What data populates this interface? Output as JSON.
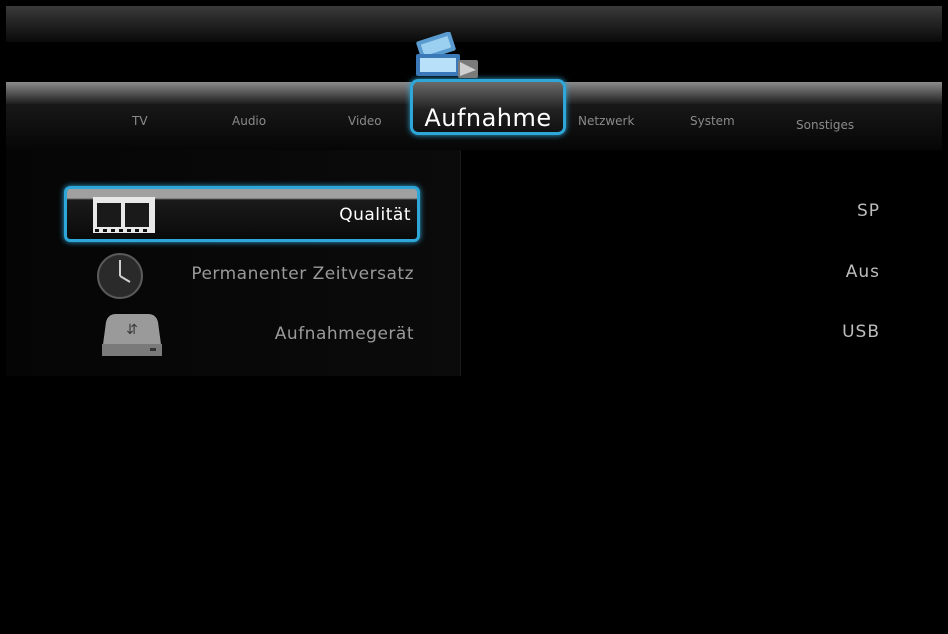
{
  "menu": {
    "tabs": [
      {
        "label": "TV"
      },
      {
        "label": "Audio"
      },
      {
        "label": "Video"
      },
      {
        "label": "Aufnahme"
      },
      {
        "label": "Netzwerk"
      },
      {
        "label": "System"
      },
      {
        "label": "Sonstiges"
      }
    ],
    "active_tab": "Aufnahme"
  },
  "settings": {
    "items": [
      {
        "label": "Qualität",
        "value": "SP",
        "icon": "film-strip-icon",
        "selected": true
      },
      {
        "label": "Permanenter Zeitversatz",
        "value": "Aus",
        "icon": "clock-icon",
        "selected": false
      },
      {
        "label": "Aufnahmegerät",
        "value": "USB",
        "icon": "usb-drive-icon",
        "selected": false
      }
    ]
  },
  "colors": {
    "accent": "#2fa6d8",
    "background": "#000000"
  }
}
